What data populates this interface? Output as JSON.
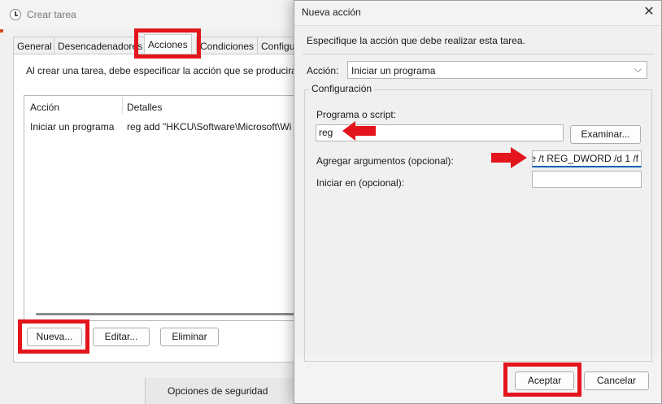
{
  "background_window": {
    "title": "Crear tarea",
    "tabs": [
      "General",
      "Desencadenadores",
      "Acciones",
      "Condiciones",
      "Configu"
    ],
    "description": "Al crear una tarea, debe especificar la acción que se producirá c",
    "list": {
      "headers": [
        "Acción",
        "Detalles"
      ],
      "rows": [
        {
          "action": "Iniciar un programa",
          "details": "reg add \"HKCU\\Software\\Microsoft\\Wi"
        }
      ]
    },
    "buttons": {
      "new": "Nueva...",
      "edit": "Editar...",
      "delete": "Eliminar"
    },
    "bottom_partial_text": "Opciones de seguridad"
  },
  "dialog": {
    "title": "Nueva acción",
    "close_glyph": "✕",
    "instruction": "Especifique la acción que debe realizar esta tarea.",
    "action_label": "Acción:",
    "action_value": "Iniciar un programa",
    "chevron_glyph": "⌵",
    "config_legend": "Configuración",
    "program_label": "Programa o script:",
    "program_value": "reg",
    "browse_button": "Examinar...",
    "args_label": "Agregar argumentos (opcional):",
    "args_value": "e /t REG_DWORD /d 1 /f",
    "start_in_label": "Iniciar en (opcional):",
    "start_in_value": "",
    "accept_button": "Aceptar",
    "cancel_button": "Cancelar"
  },
  "colors": {
    "annotation_red": "#e3141b",
    "focus_blue": "#005fb8",
    "accent_orange": "#d7491a"
  },
  "icons": {
    "window_icon": "clock-icon",
    "dialog_close": "close-icon",
    "select_chevron": "chevron-down-icon"
  }
}
